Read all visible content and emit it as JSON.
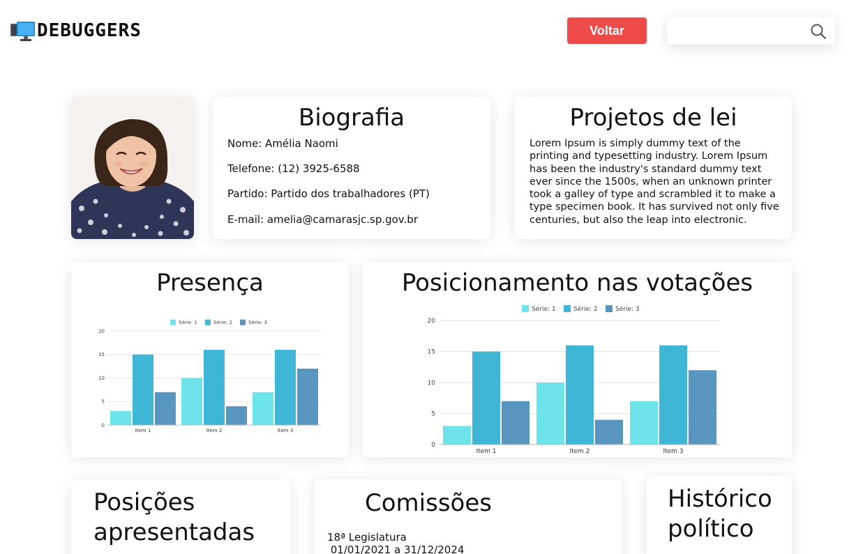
{
  "brand": {
    "name": "DEBUGGERS",
    "icon": "monitor-icon"
  },
  "header": {
    "back_label": "Voltar",
    "search_placeholder": "",
    "search_icon": "search-icon"
  },
  "bio": {
    "title": "Biografia",
    "name": "Nome: Amélia  Naomi",
    "phone": "Telefone: (12) 3925-6588",
    "party": "Partido: Partido dos trabalhadores (PT)",
    "email": "E-mail: amelia@camarasjc.sp.gov.br"
  },
  "projetos": {
    "title": "Projetos de lei",
    "body": "Lorem Ipsum is simply dummy text of the printing and typesetting industry. Lorem Ipsum has been the industry's standard dummy text ever since the 1500s, when an unknown printer took a galley of type and scrambled it to make a type specimen book. It has survived not only five centuries, but also the leap into electronic."
  },
  "presenca": {
    "title": "Presença"
  },
  "votacoes": {
    "title": "Posicionamento nas votações"
  },
  "posicoes": {
    "title_line1": "Posições",
    "title_line2": "apresentadas"
  },
  "comissoes": {
    "title": "Comissões",
    "legislatura": "18ª Legislatura",
    "periodo": " 01/01/2021 a 31/12/2024"
  },
  "historico": {
    "title_line1": "Histórico",
    "title_line2": "político"
  },
  "colors": {
    "accent": "#ef4a4a",
    "serie1": "#6de4ea",
    "serie2": "#3fb6d6",
    "serie3": "#5896bf"
  },
  "chart_data": [
    {
      "type": "bar",
      "categories": [
        "Item 1",
        "Item 2",
        "Item 3"
      ],
      "series": [
        {
          "name": "Série: 1",
          "values": [
            3,
            10,
            7
          ]
        },
        {
          "name": "Série: 2",
          "values": [
            15,
            16,
            16
          ]
        },
        {
          "name": "Série: 3",
          "values": [
            7,
            4,
            12
          ]
        }
      ],
      "ylim": [
        0,
        20
      ],
      "yticks": [
        "0",
        "5",
        "10",
        "15",
        "20"
      ],
      "legend": "top"
    },
    {
      "type": "bar",
      "categories": [
        "Item 1",
        "Item 2",
        "Item 3"
      ],
      "series": [
        {
          "name": "Série: 1",
          "values": [
            3,
            10,
            7
          ]
        },
        {
          "name": "Série: 2",
          "values": [
            15,
            16,
            16
          ]
        },
        {
          "name": "Série: 3",
          "values": [
            7,
            4,
            12
          ]
        }
      ],
      "ylim": [
        0,
        20
      ],
      "yticks": [
        "0",
        "5",
        "10",
        "15",
        "20"
      ],
      "legend": "top"
    }
  ]
}
